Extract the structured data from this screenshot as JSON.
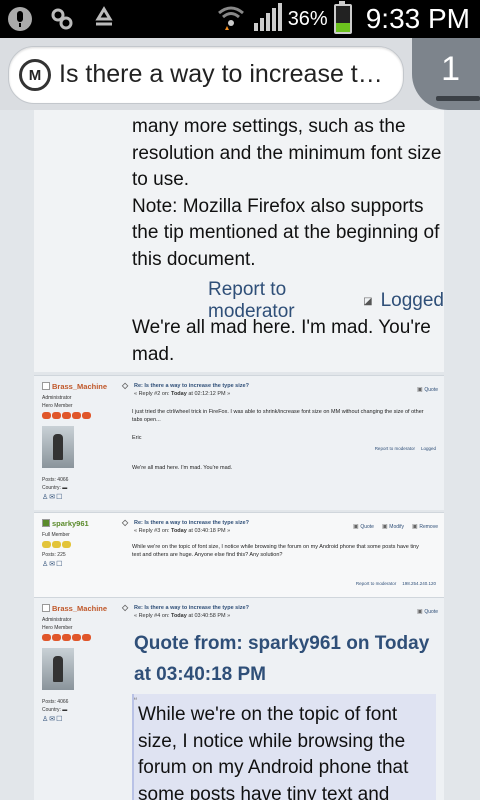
{
  "status_bar": {
    "battery_percent": "36%",
    "battery_level": 0.36,
    "time": "9:33 PM",
    "icons": [
      "microphone-icon",
      "link-icon",
      "recycle-icon",
      "wifi-icon",
      "signal-icon",
      "battery-icon"
    ]
  },
  "url_bar": {
    "favicon_letter": "M",
    "title": "Is there a way to increase th...",
    "tab_count": "1"
  },
  "post1": {
    "text": "many more settings, such as the resolution and the minimum font size to use.\nNote: Mozilla Firefox also supports the tip mentioned at the beginning of this document.",
    "report_link": "Report to moderator",
    "logged_label": "Logged",
    "signature": "We're all mad here. I'm mad. You're mad."
  },
  "post2": {
    "username": "Brass_Machine",
    "role1": "Administrator",
    "role2": "Hero Member",
    "posts": "Posts: 4066",
    "country": "Country:",
    "title": "Re: Is there a way to increase the type size?",
    "meta_prefix": "« Reply #2 on:",
    "meta_date": "Today",
    "meta_time": "at 02:12:12 PM »",
    "quote_button": "Quote",
    "body1": "I just tried the ctrl/wheel trick in FireFox. I was able to shrink/increase font size on MM without changing the size of other tabs open...",
    "body2": "Eric",
    "report_link": "Report to moderator",
    "logged_label": "Logged",
    "signature": "We're all mad here. I'm mad. You're mad."
  },
  "post3": {
    "username": "sparky961",
    "role1": "Full Member",
    "posts": "Posts: 225",
    "title": "Re: Is there a way to increase the type size?",
    "meta_prefix": "« Reply #3 on:",
    "meta_date": "Today",
    "meta_time": "at 03:40:18 PM »",
    "quote_button": "Quote",
    "modify_button": "Modify",
    "remove_button": "Remove",
    "body": "While we're on the topic of font size, I notice while browsing the forum on my Android phone that some posts have tiny text and others are huge.  Anyone else find this?  Any solution?",
    "report_link": "Report to moderator",
    "ip": "198.254.240.120"
  },
  "post4": {
    "username": "Brass_Machine",
    "role1": "Administrator",
    "role2": "Hero Member",
    "posts": "Posts: 4066",
    "country": "Country:",
    "title": "Re: Is there a way to increase the type size?",
    "meta_prefix": "« Reply #4 on:",
    "meta_date": "Today",
    "meta_time": "at 03:40:58 PM »",
    "quote_button": "Quote",
    "quote_header": "Quote from: sparky961 on Today at 03:40:18 PM",
    "quote_text": "While we're on the topic of font size, I notice while browsing the forum on my Android phone that some posts have tiny text and"
  }
}
